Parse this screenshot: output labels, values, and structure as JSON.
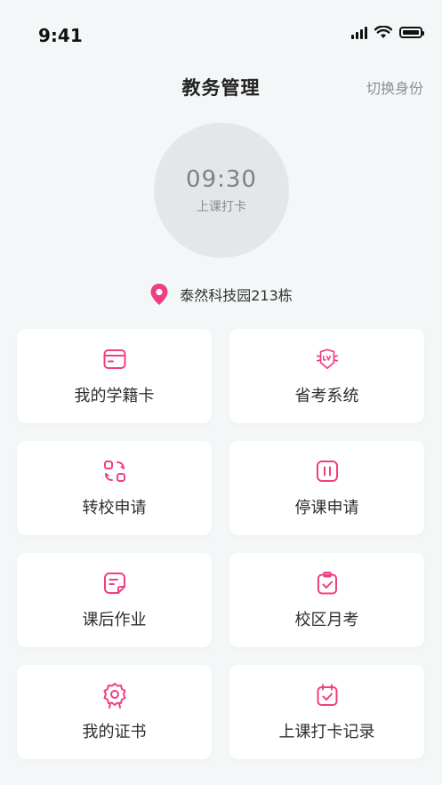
{
  "status_bar": {
    "time": "9:41"
  },
  "header": {
    "title": "教务管理",
    "switch_label": "切换身份"
  },
  "checkin": {
    "time": "09:30",
    "label": "上课打卡"
  },
  "location": {
    "text": "泰然科技园213栋"
  },
  "colors": {
    "accent": "#ef3f84",
    "background": "#f4f7f8",
    "circle": "#e4e6e8"
  },
  "menu": [
    {
      "label": "我的学籍卡",
      "icon": "card-icon"
    },
    {
      "label": "省考系统",
      "icon": "lv-badge-icon"
    },
    {
      "label": "转校申请",
      "icon": "transfer-icon"
    },
    {
      "label": "停课申请",
      "icon": "pause-icon"
    },
    {
      "label": "课后作业",
      "icon": "note-icon"
    },
    {
      "label": "校区月考",
      "icon": "clipboard-check-icon"
    },
    {
      "label": "我的证书",
      "icon": "certificate-icon"
    },
    {
      "label": "上课打卡记录",
      "icon": "calendar-check-icon"
    }
  ]
}
